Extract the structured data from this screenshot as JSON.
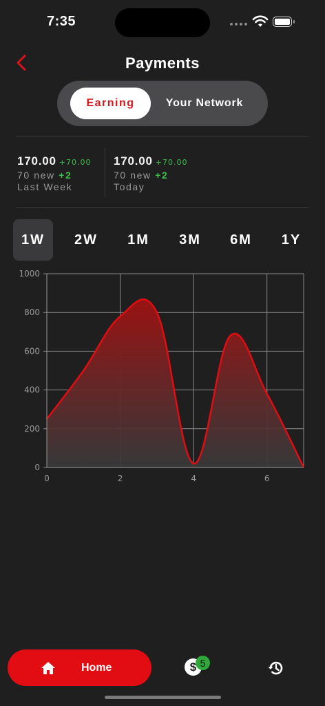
{
  "status_bar": {
    "time": "7:35"
  },
  "header": {
    "title": "Payments"
  },
  "segmented": {
    "active": "Earning",
    "inactive": "Your Network"
  },
  "stats": [
    {
      "value": "170.00",
      "delta": "+70.00",
      "new_prefix": "70 new",
      "new_delta": "+2",
      "period": "Last Week"
    },
    {
      "value": "170.00",
      "delta": "+70.00",
      "new_prefix": "70 new",
      "new_delta": "+2",
      "period": "Today"
    }
  ],
  "range_tabs": [
    "1W",
    "2W",
    "1M",
    "3M",
    "6M",
    "1Y"
  ],
  "active_range": "1W",
  "chart_data": {
    "type": "area",
    "x": [
      0,
      1,
      2,
      3,
      4,
      5,
      6,
      7
    ],
    "y": [
      250,
      500,
      780,
      800,
      20,
      680,
      380,
      0
    ],
    "xlim": [
      0,
      7
    ],
    "ylim": [
      0,
      1000
    ],
    "x_ticks": [
      0,
      2,
      4,
      6
    ],
    "y_ticks": [
      0,
      200,
      400,
      600,
      800,
      1000
    ],
    "grid": true,
    "line_color": "#e10d12",
    "fill_color": "#8f1414"
  },
  "bottom_nav": {
    "home_label": "Home",
    "payments_badge": "5",
    "payments_symbol": "$"
  },
  "colors": {
    "accent": "#e10d12",
    "background": "#1f1f20",
    "positive": "#3fbf4a"
  }
}
